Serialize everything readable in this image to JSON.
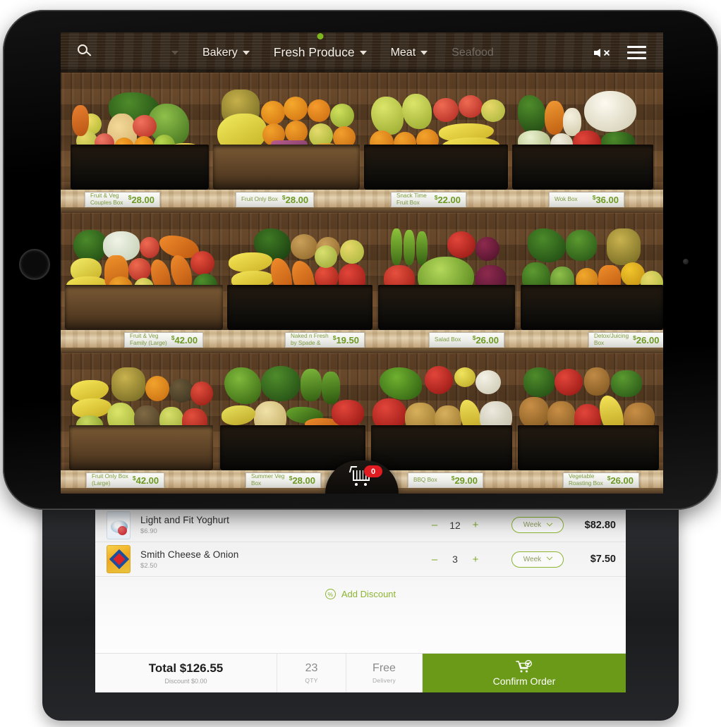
{
  "app": {
    "nav": {
      "search_icon": "search-icon",
      "mute_icon": "mute-icon",
      "menu_icon": "hamburger-menu-icon",
      "items": [
        {
          "label": "",
          "active": false,
          "faded": true
        },
        {
          "label": "Bakery",
          "active": false,
          "faded": false
        },
        {
          "label": "Fresh Produce",
          "active": true,
          "faded": false
        },
        {
          "label": "Meat",
          "active": false,
          "faded": false
        },
        {
          "label": "Seafood",
          "active": false,
          "faded": true
        }
      ]
    },
    "cart_fab": {
      "icon": "shopping-cart-icon",
      "badge_count": "0"
    },
    "shelves": [
      {
        "products": [
          {
            "name": "Fruit & Veg\nCouples Box",
            "price": "28.00"
          },
          {
            "name": "Fruit Only Box",
            "price": "28.00"
          },
          {
            "name": "Snack Time\nFruit Box",
            "price": "22.00"
          },
          {
            "name": "Wok Box",
            "price": "36.00"
          }
        ]
      },
      {
        "products": [
          {
            "name": "Fruit & Veg\nFamily (Large)",
            "price": "42.00"
          },
          {
            "name": "Naked n Fresh\nby Spade &",
            "price": "19.50"
          },
          {
            "name": "Salad Box",
            "price": "26.00"
          },
          {
            "name": "Detox/Juicing\nBox",
            "price": "26.00"
          }
        ]
      },
      {
        "products": [
          {
            "name": "Fruit Only Box\n(Large)",
            "price": "42.00"
          },
          {
            "name": "Summer Veg\nBox",
            "price": "28.00"
          },
          {
            "name": "BBQ Box",
            "price": "29.00"
          },
          {
            "name": "Vegetable\nRoasting Box",
            "price": "26.00"
          }
        ]
      }
    ]
  },
  "cart": {
    "items": [
      {
        "name": "Light and Fit Yoghurt",
        "unit_price": "$6.90",
        "qty": "12",
        "frequency": "Week",
        "line_total": "$82.80",
        "decrement": "–",
        "increment": "+"
      },
      {
        "name": "Smith Cheese & Onion",
        "unit_price": "$2.50",
        "qty": "3",
        "frequency": "Week",
        "line_total": "$7.50",
        "decrement": "–",
        "increment": "+"
      }
    ],
    "discount_label": "Add Discount",
    "discount_icon": "percent-circle-icon",
    "footer": {
      "total": "Total $126.55",
      "discount_sub": "Discount $0.00",
      "qty_value": "23",
      "qty_caption": "QTY",
      "delivery_value": "Free",
      "delivery_caption": "Delivery",
      "confirm_label": "Confirm Order",
      "confirm_icon": "cart-check-icon"
    }
  },
  "colors": {
    "brand_green": "#8cb432",
    "confirm_green": "#6a9a18",
    "price_green": "#6d9a22",
    "badge_red": "#e01b22"
  }
}
